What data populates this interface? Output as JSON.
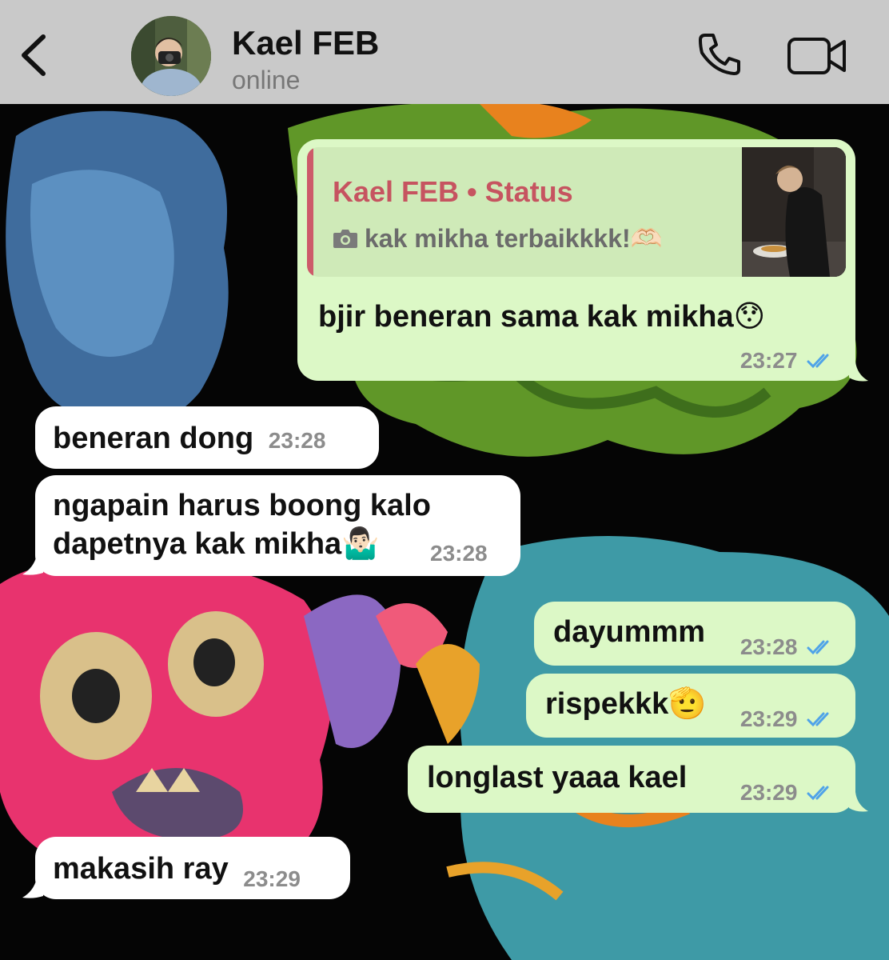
{
  "header": {
    "contact_name": "Kael FEB",
    "contact_status": "online",
    "back_icon": "chevron-left-icon",
    "call_icon": "phone-icon",
    "video_icon": "video-camera-icon",
    "background_color": "#c9c9c9"
  },
  "colors": {
    "outgoing_bubble": "#dcf8c6",
    "incoming_bubble": "#ffffff",
    "read_ticks": "#4fa3e8",
    "quote_accent": "#cd5a6a"
  },
  "messages": [
    {
      "direction": "outgoing",
      "reply": {
        "title": "Kael FEB • Status",
        "media_icon": "camera-icon",
        "text": "kak mikha terbaikkkk!🫶🏻"
      },
      "text": "bjir beneran sama kak mikha😯",
      "time": "23:27",
      "status": "read"
    },
    {
      "direction": "incoming",
      "text": "beneran dong",
      "time": "23:28"
    },
    {
      "direction": "incoming",
      "text_line1": "ngapain harus boong kalo",
      "text_line2": "dapetnya kak mikha🤷🏻‍♂️",
      "time": "23:28"
    },
    {
      "direction": "outgoing",
      "text": "dayummm",
      "time": "23:28",
      "status": "read"
    },
    {
      "direction": "outgoing",
      "text": "rispekkk🫡",
      "time": "23:29",
      "status": "read"
    },
    {
      "direction": "outgoing",
      "text": "longlast yaaa kael",
      "time": "23:29",
      "status": "read"
    },
    {
      "direction": "incoming",
      "text": "makasih ray",
      "time": "23:29"
    }
  ]
}
